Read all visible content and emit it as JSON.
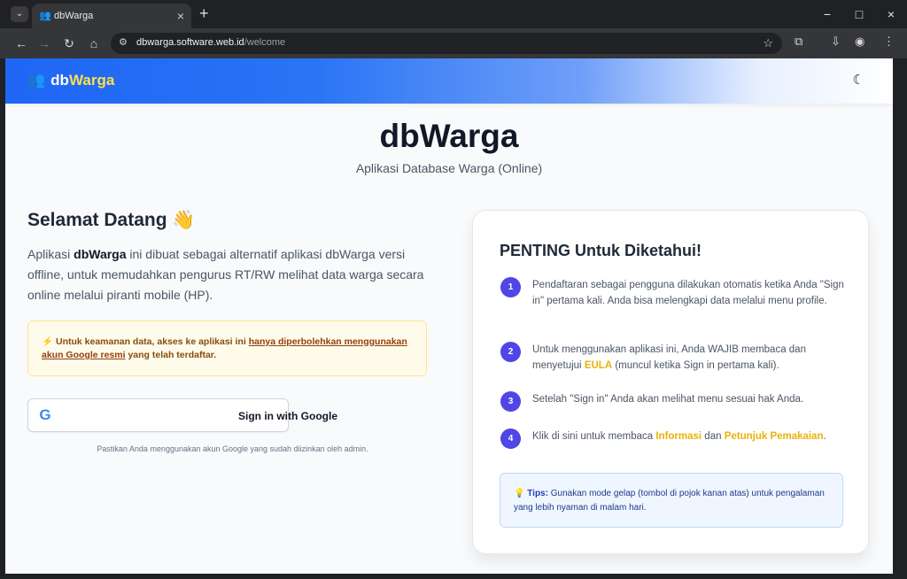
{
  "browser": {
    "tab_title": "dbWarga",
    "url_host": "dbwarga.software.web.id",
    "url_path": "/welcome"
  },
  "app": {
    "brand_db": "db",
    "brand_warga": "Warga",
    "title": "dbWarga",
    "subtitle": "Aplikasi Database Warga (Online)",
    "welcome": "Selamat Datang 👋",
    "desc_1": "Aplikasi ",
    "desc_bold": "dbWarga",
    "desc_2": " ini dibuat sebagai alternatif aplikasi dbWarga versi offline, untuk memudahkan pengurus RT/RW melihat data warga secara online melalui piranti mobile (HP).",
    "warning_1": "⚡ Untuk keamanan data, akses ke aplikasi ini ",
    "warning_link": "hanya diperbolehkan menggunakan akun Google resmi",
    "warning_2": " yang telah terdaftar.",
    "google_button": "Sign in with Google",
    "google_note": "Pastikan Anda menggunakan akun Google yang sudah diizinkan oleh admin."
  },
  "important": {
    "title": "PENTING Untuk Diketahui!",
    "steps": [
      {
        "num": "1",
        "text": "Pendaftaran sebagai pengguna dilakukan otomatis ketika Anda \"Sign in\" pertama kali. Anda bisa melengkapi data melalui menu profile."
      },
      {
        "num": "2",
        "text_1": "Untuk menggunakan aplikasi ini, Anda WAJIB membaca dan menyetujui ",
        "highlight": "EULA",
        "text_2": " (muncul ketika Sign in pertama kali)."
      },
      {
        "num": "3",
        "text": "Setelah \"Sign in\" Anda akan melihat menu sesuai hak Anda."
      },
      {
        "num": "4",
        "text_1": "Klik di sini untuk membaca ",
        "link_1": "Informasi",
        "text_2": " dan ",
        "link_2": "Petunjuk Pemakaian",
        "text_3": "."
      }
    ],
    "tip_label": "Tips:",
    "tip_text": " Gunakan mode gelap (tombol di pojok kanan atas) untuk pengalaman yang lebih nyaman di malam hari."
  }
}
